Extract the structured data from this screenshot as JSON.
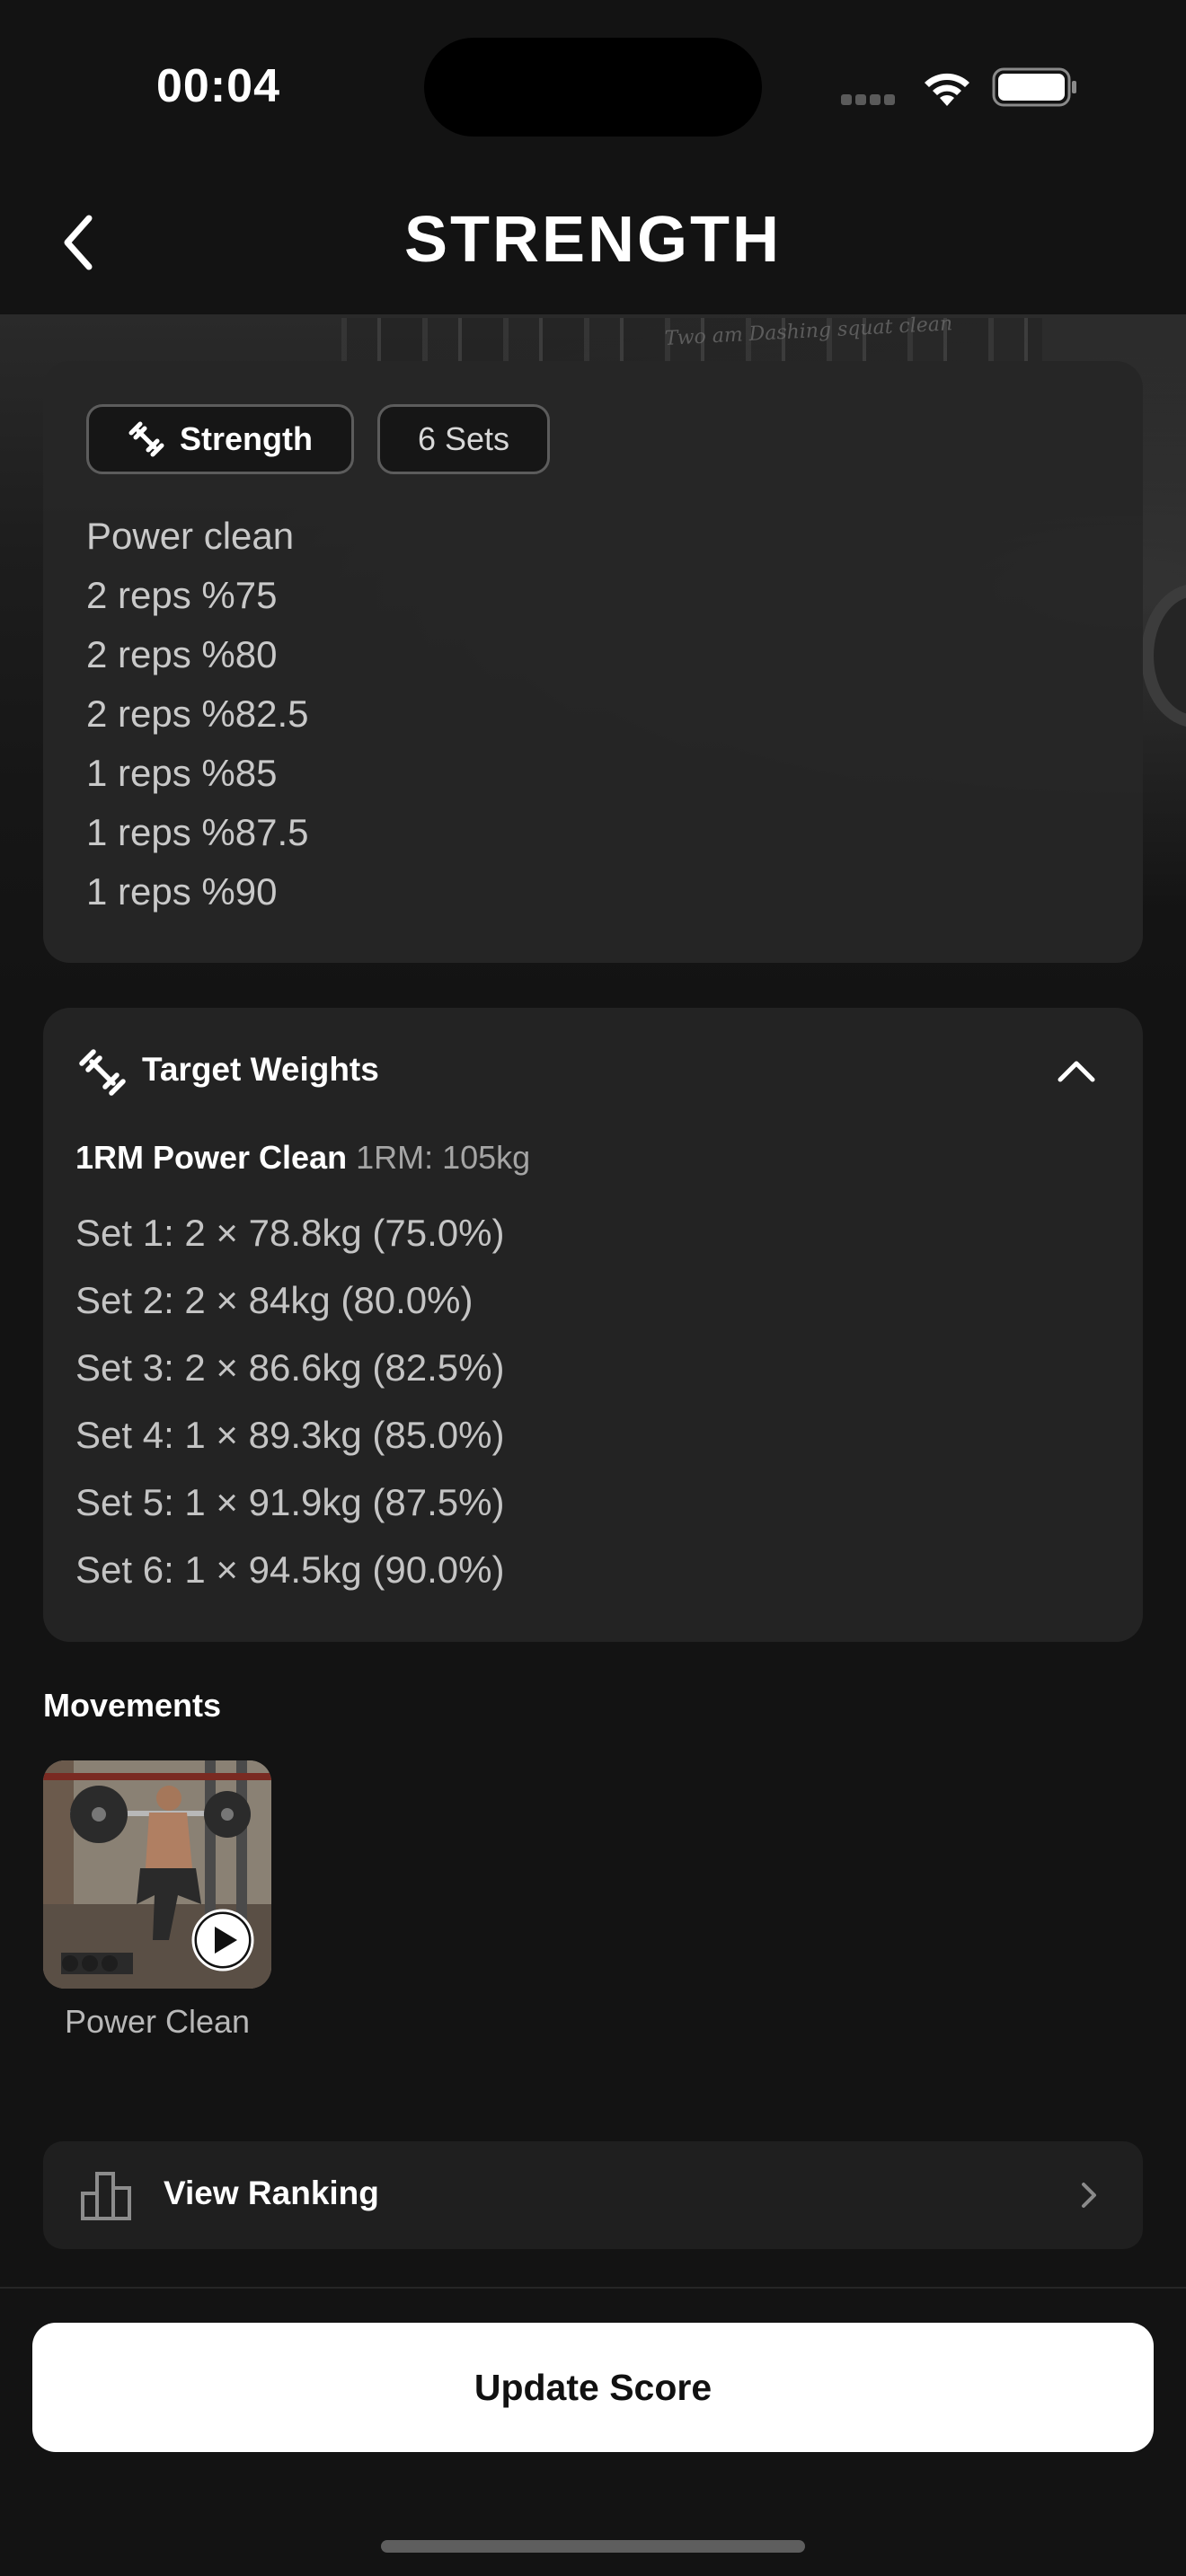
{
  "status_bar": {
    "time": "00:04"
  },
  "header": {
    "title": "STRENGTH",
    "back_icon": "chevron-left-icon"
  },
  "workout": {
    "type_chip": {
      "icon": "barbell-icon",
      "label": "Strength"
    },
    "sets_chip": {
      "label": "6 Sets"
    },
    "lines": [
      "Power clean",
      "2 reps %75",
      "2 reps %80",
      "2 reps %82.5",
      "1 reps %85",
      "1 reps %87.5",
      "1 reps %90"
    ]
  },
  "target_weights": {
    "title": "Target Weights",
    "icon": "barbell-icon",
    "toggle_icon": "chevron-up-icon",
    "one_rm_name": "1RM Power Clean",
    "one_rm_value": "1RM: 105kg",
    "sets": [
      "Set 1: 2 × 78.8kg (75.0%)",
      "Set 2: 2 × 84kg (80.0%)",
      "Set 3: 2 × 86.6kg (82.5%)",
      "Set 4: 1 × 89.3kg (85.0%)",
      "Set 5: 1 × 91.9kg (87.5%)",
      "Set 6: 1 × 94.5kg (90.0%)"
    ]
  },
  "movements": {
    "label": "Movements",
    "items": [
      {
        "name": "Power Clean",
        "play_icon": "play-icon"
      }
    ]
  },
  "ranking": {
    "label": "View Ranking",
    "icon": "bar-chart-icon",
    "chevron": "chevron-right-icon"
  },
  "footer": {
    "update_label": "Update Score"
  },
  "colors": {
    "background": "#131313",
    "card": "#232323",
    "primary_button": "#ffffff"
  }
}
